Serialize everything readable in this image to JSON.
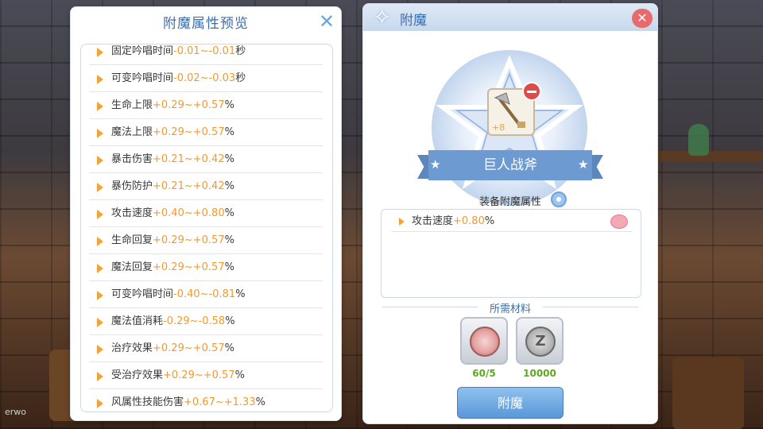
{
  "preview_panel": {
    "title": "附魔属性预览",
    "close_icon": "close-icon",
    "attributes": [
      {
        "name": "固定吟唱时间",
        "range": "-0.01~-0.01",
        "unit": "秒"
      },
      {
        "name": "可变吟唱时间",
        "range": "-0.02~-0.03",
        "unit": "秒"
      },
      {
        "name": "生命上限",
        "range": "+0.29~+0.57",
        "unit": "%"
      },
      {
        "name": "魔法上限",
        "range": "+0.29~+0.57",
        "unit": "%"
      },
      {
        "name": "暴击伤害",
        "range": "+0.21~+0.42",
        "unit": "%"
      },
      {
        "name": "暴伤防护",
        "range": "+0.21~+0.42",
        "unit": "%"
      },
      {
        "name": "攻击速度",
        "range": "+0.40~+0.80",
        "unit": "%"
      },
      {
        "name": "生命回复",
        "range": "+0.29~+0.57",
        "unit": "%"
      },
      {
        "name": "魔法回复",
        "range": "+0.29~+0.57",
        "unit": "%"
      },
      {
        "name": "可变吟唱时间",
        "range": "-0.40~-0.81",
        "unit": "%"
      },
      {
        "name": "魔法值消耗",
        "range": "-0.29~-0.58",
        "unit": "%"
      },
      {
        "name": "治疗效果",
        "range": "+0.29~+0.57",
        "unit": "%"
      },
      {
        "name": "受治疗效果",
        "range": "+0.29~+0.57",
        "unit": "%"
      },
      {
        "name": "风属性技能伤害",
        "range": "+0.67~+1.33",
        "unit": "%"
      }
    ]
  },
  "enchant_panel": {
    "title": "附魔",
    "item_name": "巨人战斧",
    "item_refine": "+8",
    "attr_section_label": "装备附魔属性",
    "current_attributes": [
      {
        "name": "攻击速度",
        "range": "+0.80",
        "unit": "%"
      }
    ],
    "materials_label": "所需材料",
    "materials": [
      {
        "icon": "enchant-coin-icon",
        "count": "60/5"
      },
      {
        "icon": "zeny-coin-icon",
        "count": "10000"
      }
    ],
    "enchant_button": "附魔"
  },
  "watermark": "erwo",
  "colors": {
    "accent_blue": "#3c6ea8",
    "value_orange": "#f29a2e",
    "count_green": "#5ea81e",
    "close_red": "#e86a6a"
  }
}
